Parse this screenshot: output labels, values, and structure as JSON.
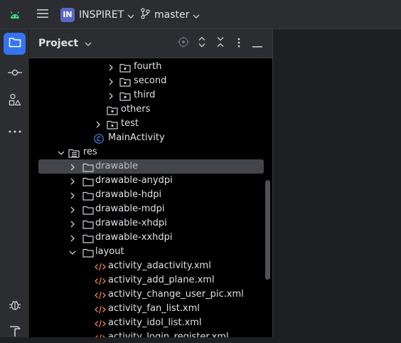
{
  "titlebar": {
    "project_badge": "IN",
    "project_name": "INSPIRET",
    "branch": "master",
    "icons": [
      "android-icon",
      "hamburger-menu-icon",
      "git-branch-icon"
    ]
  },
  "toolstrip": {
    "buttons": [
      "folder-icon",
      "commit-icon",
      "shapes-icon",
      "more-icon",
      "bug-icon",
      "hammer-icon"
    ],
    "accent": "#3574f0"
  },
  "panel": {
    "title": "Project",
    "header_icons": [
      "target-icon",
      "expand-icon",
      "collapse-icon",
      "kebab-icon",
      "minimize-icon"
    ]
  },
  "tree": [
    {
      "label": "fourth",
      "kind": "package",
      "caret": "right"
    },
    {
      "label": "second",
      "kind": "package",
      "caret": "right"
    },
    {
      "label": "third",
      "kind": "package",
      "caret": "right"
    },
    {
      "label": "others",
      "kind": "package",
      "caret": "none"
    },
    {
      "label": "test",
      "kind": "package",
      "caret": "right"
    },
    {
      "label": "MainActivity",
      "kind": "class",
      "caret": "none"
    },
    {
      "label": "res",
      "kind": "resfolder",
      "caret": "down"
    },
    {
      "label": "drawable",
      "kind": "folder",
      "caret": "right",
      "selected": true
    },
    {
      "label": "drawable-anydpi",
      "kind": "folder",
      "caret": "right"
    },
    {
      "label": "drawable-hdpi",
      "kind": "folder",
      "caret": "right"
    },
    {
      "label": "drawable-mdpi",
      "kind": "folder",
      "caret": "right"
    },
    {
      "label": "drawable-xhdpi",
      "kind": "folder",
      "caret": "right"
    },
    {
      "label": "drawable-xxhdpi",
      "kind": "folder",
      "caret": "right"
    },
    {
      "label": "layout",
      "kind": "folder",
      "caret": "down"
    },
    {
      "label": "activity_adactivity.xml",
      "kind": "xml",
      "caret": "none"
    },
    {
      "label": "activity_add_plane.xml",
      "kind": "xml",
      "caret": "none"
    },
    {
      "label": "activity_change_user_pic.xml",
      "kind": "xml",
      "caret": "none"
    },
    {
      "label": "activity_fan_list.xml",
      "kind": "xml",
      "caret": "none"
    },
    {
      "label": "activity_idol_list.xml",
      "kind": "xml",
      "caret": "none"
    },
    {
      "label": "activity_login_register.xml",
      "kind": "xml",
      "caret": "none"
    }
  ],
  "colors": {
    "titlebar_bg": "#2b2d30",
    "panel_bg": "#000000",
    "selection_bg": "#43454a",
    "xml_icon": "#e8824a",
    "class_icon": "#4a86e8",
    "text": "#dfe1e5"
  }
}
